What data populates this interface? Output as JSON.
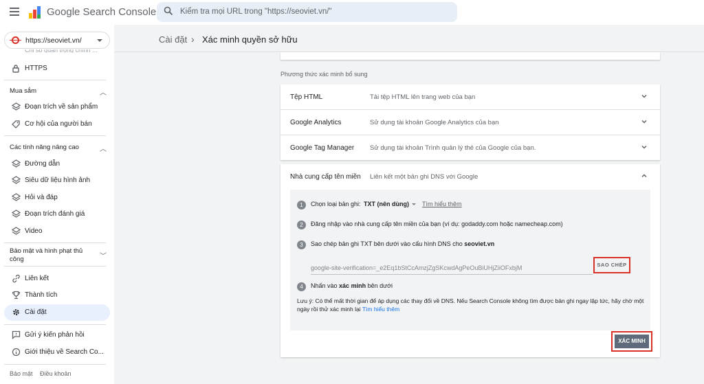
{
  "app": {
    "brand": "Google Search Console",
    "search_placeholder": "Kiểm tra mọi URL trong \"https://seoviet.vn/\""
  },
  "colors": {
    "accent": "#1a73e8",
    "highlight": "#d93025",
    "active_nav_bg": "#e8f0fe"
  },
  "sidebar": {
    "property": "https://seoviet.vn/",
    "cut_item": "Chỉ số quản trọng chính ...",
    "items_top": [
      {
        "label": "HTTPS",
        "icon": "lock-icon"
      }
    ],
    "section_shopping": "Mua sắm",
    "shopping_items": [
      {
        "label": "Đoạn trích về sản phẩm",
        "icon": "layers-icon"
      },
      {
        "label": "Cơ hội của người bán",
        "icon": "tag-icon"
      }
    ],
    "section_advanced": "Các tính năng nâng cao",
    "advanced_items": [
      {
        "label": "Đường dẫn",
        "icon": "layers-icon"
      },
      {
        "label": "Siêu dữ liệu hình ảnh",
        "icon": "layers-icon"
      },
      {
        "label": "Hỏi và đáp",
        "icon": "layers-icon"
      },
      {
        "label": "Đoạn trích đánh giá",
        "icon": "layers-icon"
      },
      {
        "label": "Video",
        "icon": "layers-icon"
      }
    ],
    "section_security": "Bảo mật và hình phạt thủ công",
    "bottom_items": [
      {
        "label": "Liên kết",
        "icon": "link-icon"
      },
      {
        "label": "Thành tích",
        "icon": "trophy-icon"
      },
      {
        "label": "Cài đặt",
        "icon": "gear-icon"
      }
    ],
    "extra_items": [
      {
        "label": "Gửi ý kiến phản hồi",
        "icon": "feedback-icon"
      },
      {
        "label": "Giới thiệu về Search Co...",
        "icon": "info-icon"
      }
    ],
    "footer": {
      "privacy": "Bảo mật",
      "terms": "Điều khoản"
    }
  },
  "breadcrumb": {
    "parent": "Cài đặt",
    "separator": "›",
    "current": "Xác minh quyền sở hữu"
  },
  "main": {
    "subheading": "Phương thức xác minh bổ sung",
    "methods": [
      {
        "title": "Tệp HTML",
        "desc": "Tải tệp HTML lên trang web của bạn"
      },
      {
        "title": "Google Analytics",
        "desc": "Sử dụng tài khoản Google Analytics của bạn"
      },
      {
        "title": "Google Tag Manager",
        "desc": "Sử dụng tài khoản Trình quản lý thẻ của Google của bạn."
      }
    ],
    "dns": {
      "title": "Nhà cung cấp tên miền",
      "desc": "Liên kết một bản ghi DNS với Google",
      "step1_label": "Chọn loại bản ghi:",
      "step1_value": "TXT (nên dùng)",
      "step1_learn": "Tìm hiểu thêm",
      "step2": "Đăng nhập vào nhà cung cấp tên miền của bạn (ví dụ: godaddy.com hoặc namecheap.com)",
      "step3_prefix": "Sao chép bản ghi TXT bên dưới vào cấu hình DNS cho",
      "step3_domain": "seoviet.vn",
      "token": "google-site-verification=_e2Eq1bStCcAmzjZgSKcwdAgPeOuBiUHjZiiOFxbjM",
      "copy_label": "SAO CHÉP",
      "step4_prefix": "Nhấn vào",
      "step4_bold": "xác minh",
      "step4_suffix": "bên dưới",
      "note": "Lưu ý: Có thể mất thời gian để áp dụng các thay đổi về DNS. Nếu Search Console không tìm được bản ghi ngay lập tức, hãy chờ một ngày rồi thử xác minh lại",
      "note_link": "Tìm hiểu thêm",
      "verify_label": "XÁC MINH"
    }
  }
}
